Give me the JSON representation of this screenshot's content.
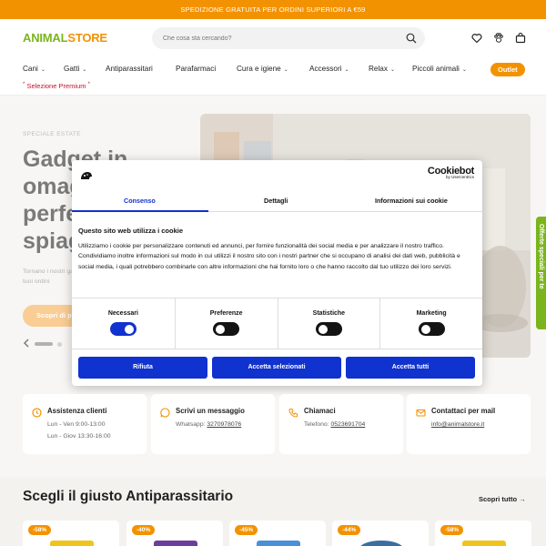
{
  "topbar": {
    "text": "SPEDIZIONE GRATUITA PER ORDINI SUPERIORI A €59"
  },
  "header": {
    "logo_part1": "ANIMAL",
    "logo_part2": "STORE",
    "search_placeholder": "Che cosa sta cercando?",
    "icons": [
      "heart-icon",
      "paw-icon",
      "cart-icon"
    ]
  },
  "nav": {
    "items": [
      {
        "label": "Cani",
        "chevron": true
      },
      {
        "label": "Gatti",
        "chevron": true
      },
      {
        "label": "Antiparassitari",
        "chevron": false
      },
      {
        "label": "Parafarmaci",
        "chevron": false
      },
      {
        "label": "Cura e igiene",
        "chevron": true
      },
      {
        "label": "Accessori",
        "chevron": true
      },
      {
        "label": "Relax",
        "chevron": true
      },
      {
        "label": "Piccoli animali",
        "chevron": true
      }
    ],
    "outlet": "Outlet",
    "premium": "Selezione Premium",
    "star": "*"
  },
  "hero": {
    "kicker": "SPECIALE ESTATE",
    "title": "Gadget in omaggio perfetti per la spiaggia",
    "text": "Tornano i nostri gadget estivi gratuiti, che puoi ricevere con i tuoi ordini",
    "button": "Scopri di più"
  },
  "side_tab": {
    "label": "Offerte speciali per te"
  },
  "cookie": {
    "brand": "Cookiebot",
    "brand_by": "by Usercentrics",
    "tabs": [
      "Consenso",
      "Dettagli",
      "Informazioni sui cookie"
    ],
    "heading": "Questo sito web utilizza i cookie",
    "body": "Utilizziamo i cookie per personalizzare contenuti ed annunci, per fornire funzionalità dei social media e per analizzare il nostro traffico. Condividiamo inoltre informazioni sul modo in cui utilizzi il nostro sito con i nostri partner che si occupano di analisi dei dati web, pubblicità e social media, i quali potrebbero combinarle con altre informazioni che hai fornito loro o che hanno raccolto dal tuo utilizzo dei loro servizi.",
    "toggles": [
      {
        "label": "Necessari",
        "state": "on"
      },
      {
        "label": "Preferenze",
        "state": "off"
      },
      {
        "label": "Statistiche",
        "state": "off"
      },
      {
        "label": "Marketing",
        "state": "off"
      }
    ],
    "buttons": {
      "deny": "Rifiuta",
      "selected": "Accetta selezionati",
      "all": "Accetta tutti"
    },
    "accent_color": "#1032cf"
  },
  "contacts": [
    {
      "icon": "clock-icon",
      "title": "Assistenza clienti",
      "line1": "Lun - Ven 9:00-13:00",
      "line2": "Lun - Giov 13:30-16:00"
    },
    {
      "icon": "whatsapp-icon",
      "title": "Scrivi un messaggio",
      "line1_prefix": "Whatsapp: ",
      "line1_link": "3270978076"
    },
    {
      "icon": "phone-icon",
      "title": "Chiamaci",
      "line1_prefix": "Telefono: ",
      "line1_link": "0523691704"
    },
    {
      "icon": "mail-icon",
      "title": "Contattaci per mail",
      "line1_link": "info@animalstore.it"
    }
  ],
  "section": {
    "title": "Scegli il giusto Antiparassitario",
    "link": "Scopri tutto →"
  },
  "products": [
    {
      "badge": "-58%"
    },
    {
      "badge": "-40%"
    },
    {
      "badge": "-45%"
    },
    {
      "badge": "-44%"
    },
    {
      "badge": "-58%"
    }
  ],
  "colors": {
    "brand_orange": "#f39200",
    "brand_green": "#7ab51d"
  }
}
